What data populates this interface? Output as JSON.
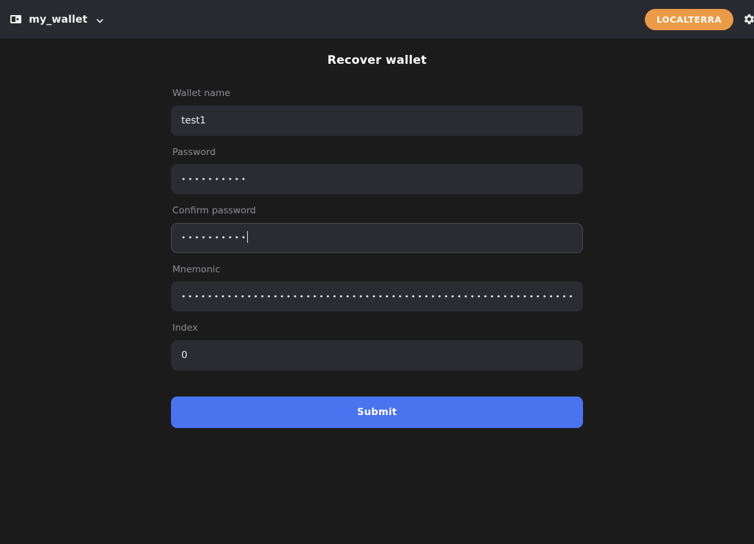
{
  "header": {
    "wallet_icon": "wallet-icon",
    "wallet_name": "my_wallet",
    "chevron_icon": "chevron-down-icon",
    "network_label": "LOCALTERRA",
    "settings_icon": "gear-icon",
    "background_color": "#292a2f",
    "network_color": "#eb9b48"
  },
  "main": {
    "title": "Recover wallet",
    "background_color": "#1b1b1b",
    "fields": [
      {
        "name": "wallet-name",
        "label": "Wallet name",
        "value": "test1",
        "masked": false,
        "focused": false,
        "placeholder": ""
      },
      {
        "name": "password",
        "label": "Password",
        "value": "••••••••••",
        "masked": true,
        "focused": false,
        "placeholder": ""
      },
      {
        "name": "confirm-password",
        "label": "Confirm password",
        "value": "••••••••••",
        "masked": true,
        "focused": true,
        "placeholder": ""
      },
      {
        "name": "mnemonic",
        "label": "Mnemonic",
        "value": "••••••••••••••••••••••••••••••••••••••••••••••••••••••••••••••••••••••••••••••••••••••••••••••••••••••••••••••••••••••••••••••••••••",
        "masked": true,
        "focused": false,
        "placeholder": ""
      },
      {
        "name": "index",
        "label": "Index",
        "value": "0",
        "masked": false,
        "focused": false,
        "placeholder": ""
      }
    ],
    "submit_label": "Submit",
    "submit_color": "#4a73f0"
  }
}
